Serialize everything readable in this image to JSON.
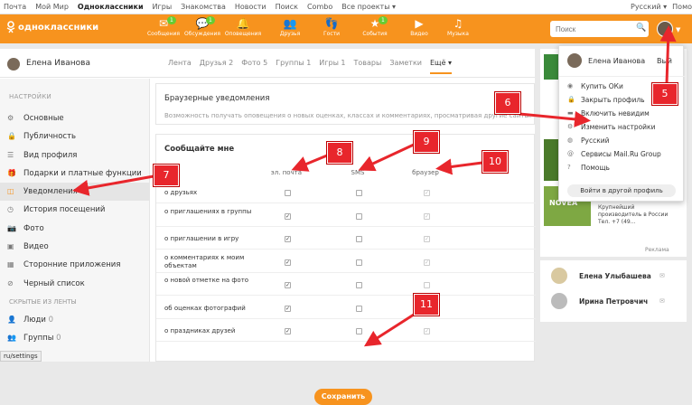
{
  "topbar": {
    "links": [
      "Почта",
      "Мой Мир",
      "Одноклассники",
      "Игры",
      "Знакомства",
      "Новости",
      "Поиск",
      "Combo",
      "Все проекты ▾"
    ],
    "lang": "Русский ▾",
    "help": "Помо"
  },
  "header": {
    "logo": "одноклассники",
    "nav": [
      {
        "label": "Сообщения",
        "icon": "envelope-icon",
        "badge": "1"
      },
      {
        "label": "Обсуждения",
        "icon": "chat-icon",
        "badge": "1"
      },
      {
        "label": "Оповещения",
        "icon": "bell-icon",
        "badge": ""
      },
      {
        "label": "Друзья",
        "icon": "friends-icon",
        "badge": ""
      },
      {
        "label": "Гости",
        "icon": "footprints-icon",
        "badge": ""
      },
      {
        "label": "События",
        "icon": "events-icon",
        "badge": "1"
      },
      {
        "label": "Видео",
        "icon": "video-icon",
        "badge": ""
      },
      {
        "label": "Музыка",
        "icon": "music-icon",
        "badge": ""
      }
    ],
    "search_placeholder": "Поиск"
  },
  "profile": {
    "name": "Елена Иванова",
    "tabs": [
      "Лента",
      "Друзья 2",
      "Фото 5",
      "Группы 1",
      "Игры 1",
      "Товары",
      "Заметки",
      "Ещё ▾"
    ]
  },
  "sidebar": {
    "heading": "НАСТРОЙКИ",
    "items": [
      "Основные",
      "Публичность",
      "Вид профиля",
      "Подарки и платные функции",
      "Уведомления",
      "История посещений",
      "Фото",
      "Видео",
      "Сторонние приложения",
      "Черный список"
    ],
    "hidden_heading": "СКРЫТЫЕ ИЗ ЛЕНТЫ",
    "hidden_items": [
      {
        "label": "Люди",
        "count": "0"
      },
      {
        "label": "Группы",
        "count": "0"
      }
    ]
  },
  "browser_notifications": {
    "title": "Браузерные уведомления",
    "desc": "Возможность получать оповещения о новых оценках, классах и комментариях, просматривая другие сайты."
  },
  "notify": {
    "title": "Сообщайте мне",
    "columns": [
      "эл. почта",
      "SMS",
      "браузер"
    ],
    "rows": [
      {
        "label": "о друзьях",
        "email": false,
        "sms": false,
        "browser": true
      },
      {
        "label": "о приглашениях в группы",
        "email": true,
        "sms": false,
        "browser": true
      },
      {
        "label": "о приглашении в игру",
        "email": true,
        "sms": false,
        "browser": true
      },
      {
        "label": "о комментариях к моим объектам",
        "email": true,
        "sms": false,
        "browser": true
      },
      {
        "label": "о новой отметке на фото",
        "email": true,
        "sms": false,
        "browser": false
      },
      {
        "label": "об оценках фотографий",
        "email": true,
        "sms": false,
        "browser": false
      },
      {
        "label": "о праздниках друзей",
        "email": true,
        "sms": false,
        "browser": true
      }
    ],
    "save": "Сохранить"
  },
  "dropdown": {
    "name": "Елена Иванова",
    "exit": "Вый",
    "items": [
      {
        "label": "Купить ОКи",
        "icon": "coin-icon"
      },
      {
        "label": "Закрыть профиль",
        "icon": "lock-icon"
      },
      {
        "label": "Включить невидим",
        "icon": "invisible-icon"
      },
      {
        "label": "Изменить настройки",
        "icon": "gear-icon"
      },
      {
        "label": "Русский",
        "icon": "globe-icon"
      },
      {
        "label": "Сервисы Mail.Ru Group",
        "icon": "at-icon"
      },
      {
        "label": "Помощь",
        "icon": "help-icon"
      }
    ],
    "switch": "Войти в другой профиль"
  },
  "ad": {
    "brand": "NOVEA",
    "text": "Крупнейший производитель в России Тел. +7 (49...",
    "label": "Реклама"
  },
  "friends": [
    {
      "name": "Елена Улыбашева"
    },
    {
      "name": "Ирина Петровчич"
    }
  ],
  "callouts": [
    "5",
    "6",
    "7",
    "8",
    "9",
    "10",
    "11"
  ],
  "status": "ru/settings",
  "colors": {
    "accent": "#f7931e",
    "callout": "#e8262c",
    "badge": "#66cc33"
  }
}
